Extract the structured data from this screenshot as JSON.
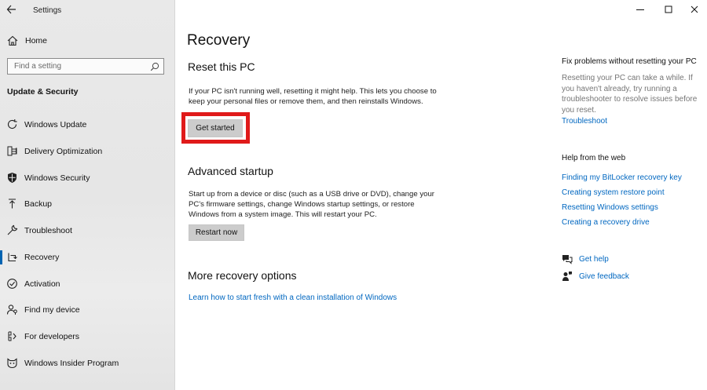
{
  "window": {
    "title": "Settings"
  },
  "sidebar": {
    "home_label": "Home",
    "search_placeholder": "Find a setting",
    "section_title": "Update & Security",
    "items": [
      {
        "label": "Windows Update",
        "icon": "refresh-icon"
      },
      {
        "label": "Delivery Optimization",
        "icon": "delivery-optimization-icon"
      },
      {
        "label": "Windows Security",
        "icon": "shield-icon"
      },
      {
        "label": "Backup",
        "icon": "backup-arrow-icon"
      },
      {
        "label": "Troubleshoot",
        "icon": "wrench-icon"
      },
      {
        "label": "Recovery",
        "icon": "recovery-icon",
        "active": true
      },
      {
        "label": "Activation",
        "icon": "check-circle-icon"
      },
      {
        "label": "Find my device",
        "icon": "person-location-icon"
      },
      {
        "label": "For developers",
        "icon": "developer-tools-icon"
      },
      {
        "label": "Windows Insider Program",
        "icon": "insider-cat-icon"
      }
    ]
  },
  "main": {
    "title": "Recovery",
    "reset": {
      "heading": "Reset this PC",
      "description": "If your PC isn't running well, resetting it might help. This lets you choose to keep your personal files or remove them, and then reinstalls Windows.",
      "button_label": "Get started"
    },
    "advanced": {
      "heading": "Advanced startup",
      "description": "Start up from a device or disc (such as a USB drive or DVD), change your PC's firmware settings, change Windows startup settings, or restore Windows from a system image. This will restart your PC.",
      "button_label": "Restart now"
    },
    "more": {
      "heading": "More recovery options",
      "link": "Learn how to start fresh with a clean installation of Windows"
    }
  },
  "right_panel": {
    "fix_heading": "Fix problems without resetting your PC",
    "fix_text": "Resetting your PC can take a while. If you haven't already, try running a troubleshooter to resolve issues before you reset.",
    "troubleshoot_link": "Troubleshoot",
    "web_heading": "Help from the web",
    "web_links": [
      "Finding my BitLocker recovery key",
      "Creating system restore point",
      "Resetting Windows settings",
      "Creating a recovery drive"
    ],
    "get_help": "Get help",
    "give_feedback": "Give feedback"
  },
  "colors": {
    "accent": "#0067c0",
    "highlight_box": "#e01a1a",
    "button_bg": "#cccccc"
  }
}
